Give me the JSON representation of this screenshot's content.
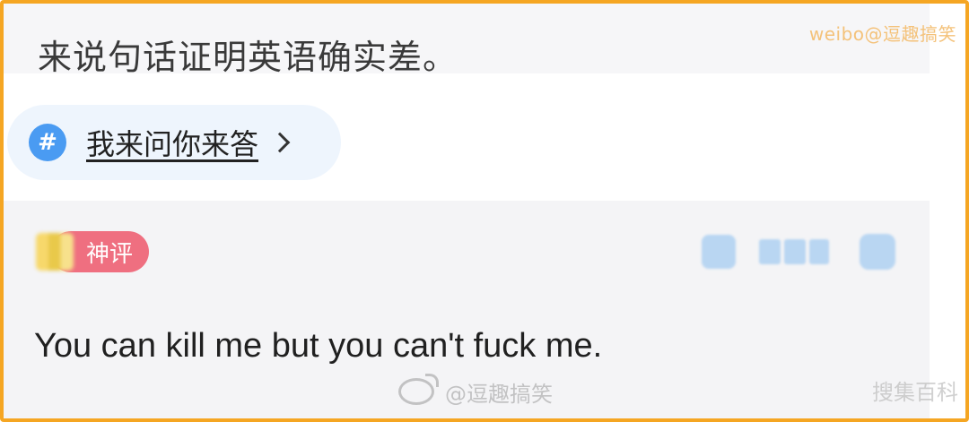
{
  "post": {
    "text": "来说句话证明英语确实差。"
  },
  "watermarks": {
    "top_right": "weibo@逗趣搞笑",
    "bottom_center": "@逗趣搞笑",
    "bottom_corner": "搜集百科"
  },
  "topic": {
    "hash_symbol": "#",
    "label": "我来问你来答"
  },
  "comment": {
    "badge_label": "神评",
    "text": "You can kill me but you can't fuck me."
  },
  "icons": {
    "topic": "hash-icon",
    "topic_arrow": "chevron-right-icon",
    "like": "thumbs-up-icon",
    "reply": "comment-icon",
    "weibo": "weibo-logo-icon"
  },
  "colors": {
    "frame": "#f5a623",
    "topic_chip_bg": "#eef5fd",
    "hash_icon_bg": "#4a9bf2",
    "badge_bg": "#ef6f80",
    "comment_bg": "#f4f4f6"
  }
}
